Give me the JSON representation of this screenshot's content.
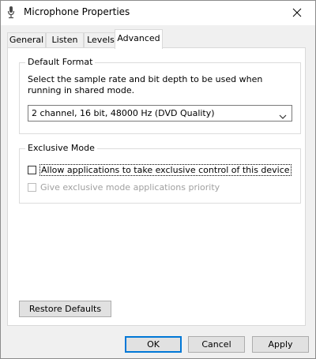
{
  "window": {
    "title": "Microphone Properties",
    "close_icon": "close-icon",
    "title_icon": "microphone-icon"
  },
  "tabs": [
    {
      "label": "General",
      "active": false
    },
    {
      "label": "Listen",
      "active": false
    },
    {
      "label": "Levels",
      "active": false
    },
    {
      "label": "Advanced",
      "active": true
    }
  ],
  "default_format": {
    "label": "Default Format",
    "description": "Select the sample rate and bit depth to be used when running in shared mode.",
    "selected": "2 channel, 16 bit, 48000 Hz (DVD Quality)"
  },
  "exclusive_mode": {
    "label": "Exclusive Mode",
    "allow": {
      "label": "Allow applications to take exclusive control of this device",
      "checked": false,
      "enabled": true
    },
    "priority": {
      "label": "Give exclusive mode applications priority",
      "checked": false,
      "enabled": false
    }
  },
  "buttons": {
    "restore": "Restore Defaults",
    "ok": "OK",
    "cancel": "Cancel",
    "apply": "Apply"
  }
}
